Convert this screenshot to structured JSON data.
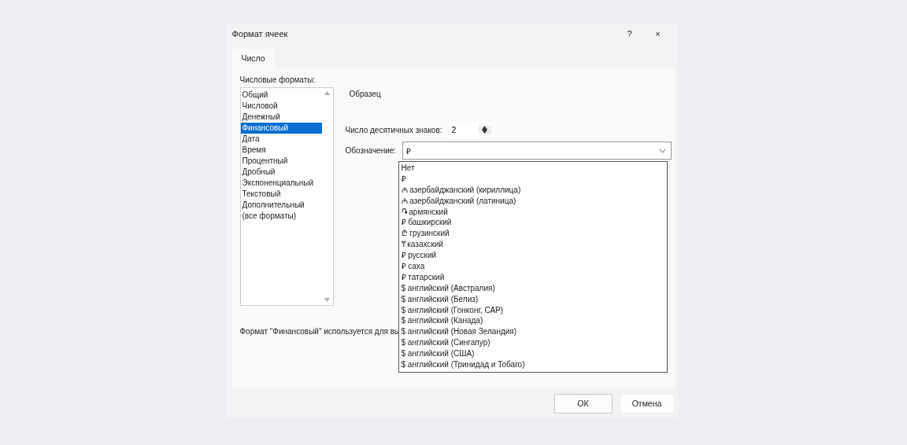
{
  "window": {
    "title": "Формат ячеек",
    "help": "?",
    "close": "×"
  },
  "tabs": [
    {
      "label": "Число",
      "selected": true
    }
  ],
  "formats": {
    "label": "Числовые форматы:",
    "items": [
      {
        "label": "Общий",
        "selected": false
      },
      {
        "label": "Числовой",
        "selected": false
      },
      {
        "label": "Денежный",
        "selected": false
      },
      {
        "label": "Финансовый",
        "selected": true
      },
      {
        "label": "Дата",
        "selected": false
      },
      {
        "label": "Время",
        "selected": false
      },
      {
        "label": "Процентный",
        "selected": false
      },
      {
        "label": "Дробный",
        "selected": false
      },
      {
        "label": "Экспоненциальный",
        "selected": false
      },
      {
        "label": "Текстовый",
        "selected": false
      },
      {
        "label": "Дополнительный",
        "selected": false
      },
      {
        "label": "(все форматы)",
        "selected": false
      }
    ]
  },
  "sample": {
    "label": "Образец"
  },
  "decimals": {
    "label": "Число десятичных знаков:",
    "value": "2"
  },
  "symbol": {
    "label": "Обозначение:",
    "value": "₽",
    "expanded": true,
    "options": [
      "Нет",
      "₽",
      "₼ азербайджанский (кириллица)",
      "₼ азербайджанский (латиница)",
      "֏ армянский",
      "₽ башкирский",
      "₾ грузинский",
      "₸ казахский",
      "₽ русский",
      "₽ саха",
      "₽ татарский",
      "$ английский (Австралия)",
      "$ английский (Белиз)",
      "$ английский (Гонконг, САР)",
      "$ английский (Канада)",
      "$ английский (Новая Зеландия)",
      "$ английский (Сингапур)",
      "$ английский (США)",
      "$ английский (Тринидад и Тобаго)"
    ]
  },
  "description": "Формат \"Финансовый\" используется для вы",
  "buttons": [
    {
      "label": "ОК",
      "kind": "primary"
    },
    {
      "label": "Отмена",
      "kind": "secondary"
    }
  ]
}
